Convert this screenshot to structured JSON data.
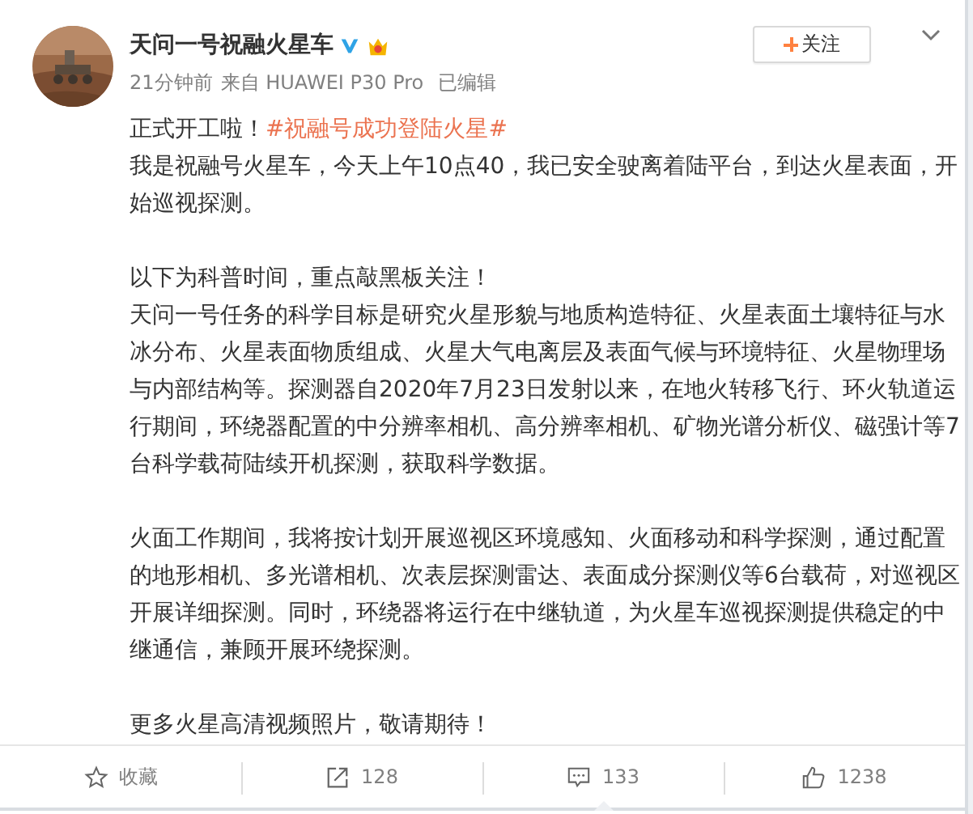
{
  "author": {
    "name": "天问一号祝融火星车",
    "time": "21分钟前",
    "source": "来自 HUAWEI P30 Pro",
    "edited": "已编辑"
  },
  "follow_button": {
    "label": "关注"
  },
  "post": [
    [
      [
        {
          "kind": "text",
          "text": "正式开工啦！"
        },
        {
          "kind": "hashtag",
          "text": "#祝融号成功登陆火星#"
        }
      ],
      [
        {
          "kind": "text",
          "text": "我是祝融号火星车，今天上午10点40，我已安全驶离着陆平台，到达火星表面，开始巡视探测。"
        }
      ]
    ],
    [
      [
        {
          "kind": "text",
          "text": "以下为科普时间，重点敲黑板关注！"
        }
      ],
      [
        {
          "kind": "text",
          "text": "天问一号任务的科学目标是研究火星形貌与地质构造特征、火星表面土壤特征与水冰分布、火星表面物质组成、火星大气电离层及表面气候与环境特征、火星物理场与内部结构等。探测器自2020年7月23日发射以来，在地火转移飞行、环火轨道运行期间，环绕器配置的中分辨率相机、高分辨率相机、矿物光谱分析仪、磁强计等7台科学载荷陆续开机探测，获取科学数据。"
        }
      ]
    ],
    [
      [
        {
          "kind": "text",
          "text": "火面工作期间，我将按计划开展巡视区环境感知、火面移动和科学探测，通过配置的地形相机、多光谱相机、次表层探测雷达、表面成分探测仪等6台载荷，对巡视区开展详细探测。同时，环绕器将运行在中继轨道，为火星车巡视探测提供稳定的中继通信，兼顾开展环绕探测。"
        }
      ]
    ],
    [
      [
        {
          "kind": "text",
          "text": "更多火星高清视频照片，敬请期待！"
        }
      ]
    ]
  ],
  "actions": [
    {
      "kind": "star",
      "label": "收藏",
      "selected": false
    },
    {
      "kind": "share",
      "label": "128",
      "selected": false
    },
    {
      "kind": "comment",
      "label": "133",
      "selected": true
    },
    {
      "kind": "like",
      "label": "1238",
      "selected": false
    }
  ]
}
